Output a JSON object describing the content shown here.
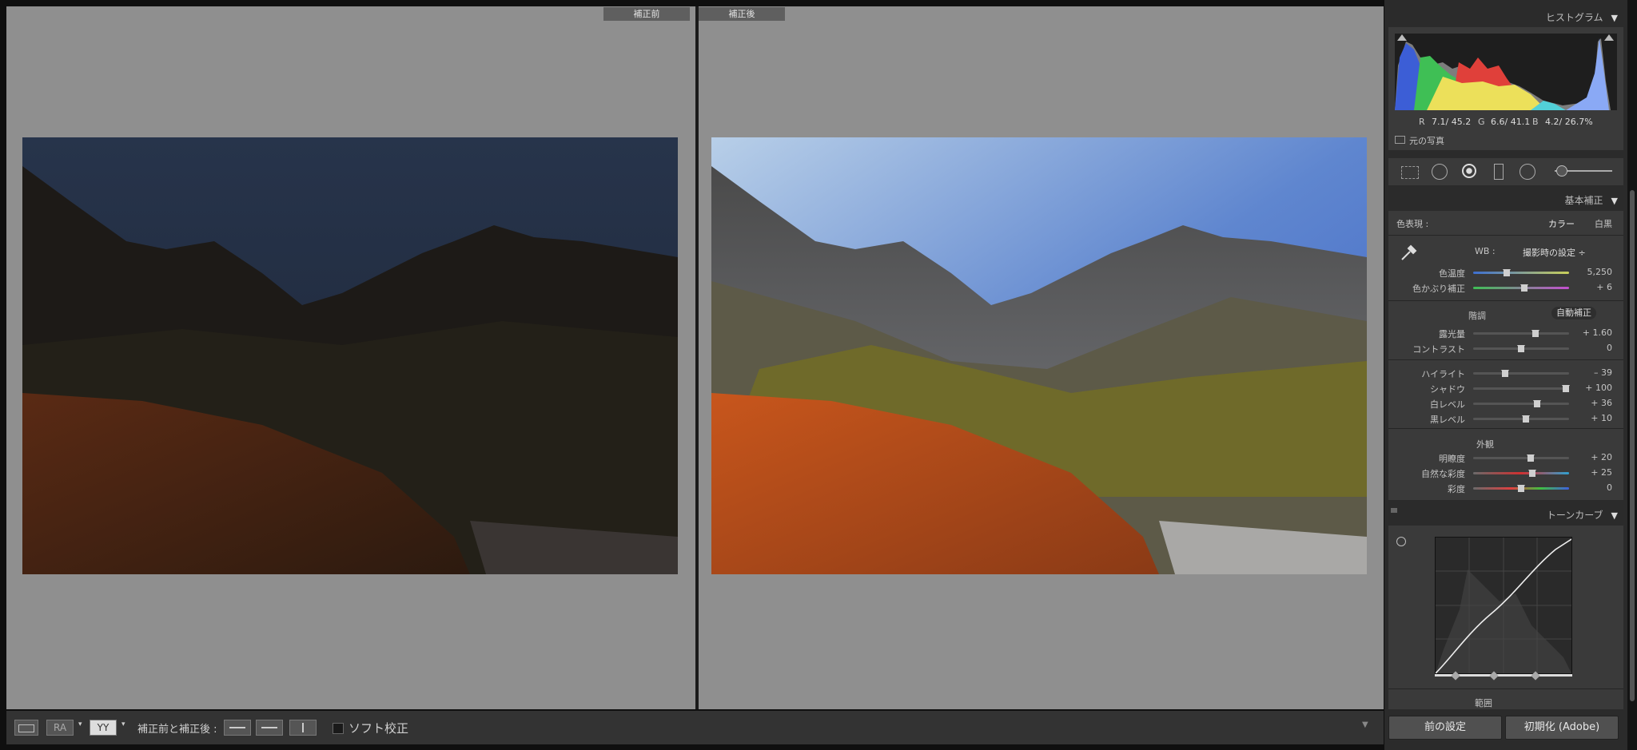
{
  "compare": {
    "before_label": "補正前",
    "after_label": "補正後"
  },
  "toolbar": {
    "view_loupe_icon": "loupe-view-icon",
    "compare_ab_label": "RA",
    "compare_yy_label": "YY",
    "before_after_label": "補正前と補正後 :",
    "softproof_label": "ソフト校正",
    "softproof_checked": false
  },
  "panel": {
    "histogram": {
      "title": "ヒストグラム",
      "r_label": "R",
      "r_value": "7.1/ 45.2",
      "g_label": "G",
      "g_value": "6.6/ 41.1",
      "b_label": "B",
      "b_value": "4.2/ 26.7%",
      "original_photo_label": "元の写真"
    },
    "basic": {
      "title": "基本補正",
      "treatment_label": "色表現 :",
      "color_option": "カラー",
      "bw_option": "白黒",
      "wb_label": "WB :",
      "wb_value": "撮影時の設定 ÷",
      "sliders_wb": [
        {
          "label": "色温度",
          "value": "5,250",
          "pos": 0.35
        },
        {
          "label": "色かぶり補正",
          "value": "+ 6",
          "pos": 0.53
        }
      ],
      "tone_label": "階調",
      "auto_label": "自動補正",
      "sliders_tone_a": [
        {
          "label": "露光量",
          "value": "+ 1.60",
          "pos": 0.65
        },
        {
          "label": "コントラスト",
          "value": "0",
          "pos": 0.5
        }
      ],
      "sliders_tone_b": [
        {
          "label": "ハイライト",
          "value": "– 39",
          "pos": 0.33
        },
        {
          "label": "シャドウ",
          "value": "+ 100",
          "pos": 0.97
        },
        {
          "label": "白レベル",
          "value": "+ 36",
          "pos": 0.67
        },
        {
          "label": "黒レベル",
          "value": "+ 10",
          "pos": 0.55
        }
      ],
      "presence_label": "外観",
      "sliders_presence": [
        {
          "label": "明瞭度",
          "value": "+ 20",
          "pos": 0.6
        },
        {
          "label": "自然な彩度",
          "value": "+ 25",
          "pos": 0.62
        },
        {
          "label": "彩度",
          "value": "0",
          "pos": 0.5
        }
      ]
    },
    "tonecurve": {
      "title": "トーンカーブ",
      "range_label": "範囲"
    },
    "buttons": {
      "previous": "前の設定",
      "reset": "初期化 (Adobe)"
    }
  }
}
